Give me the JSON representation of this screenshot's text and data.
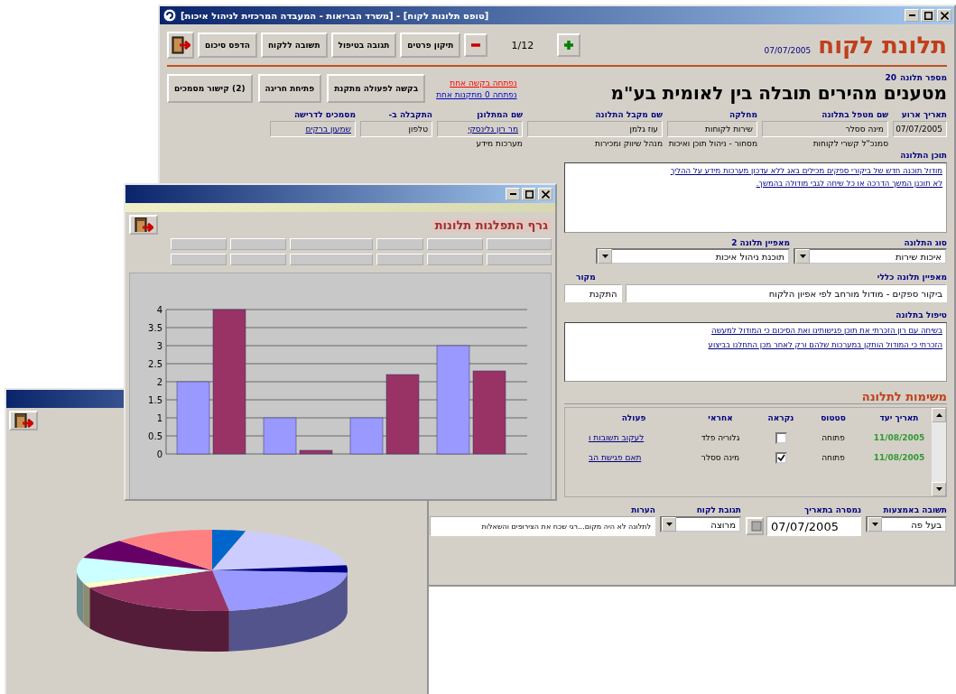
{
  "main_window": {
    "title": "[משרד הבריאות - המעבדה המרכזית לניהול איכות] - [טופס תלונות לקוח]",
    "form_title": "תלונת לקוח",
    "form_date": "07/07/2005",
    "toolbar_buttons": [
      "תיקון פרטים",
      "תגובה בטיפול",
      "תשובה ללקוח",
      "הדפס סיכום"
    ],
    "record_position": "1/12",
    "complaint_number_label": "מספר תלונה",
    "complaint_number": "20",
    "customer_name": "מטענים מהירים תובלה בין לאומית בע\"מ",
    "status_links": [
      {
        "text": "נפתחה בקשה אחת",
        "color": "#ff0000"
      },
      {
        "text": "נפתחה 0 מתקנות אחת",
        "color": "#0000cc"
      }
    ],
    "action_buttons": [
      "בקשה לפעולה מתקנת",
      "פתיחת חריגה",
      "(2) קישור מסמכים"
    ],
    "fields": [
      {
        "label": "תאריך ארוע",
        "value": "07/07/2005",
        "kind": "text"
      },
      {
        "label": "שם מטפל בתלונה",
        "value": "מינה ססלר",
        "note": "סמנכ\"ל קשרי לקוחות",
        "kind": "text"
      },
      {
        "label": "מחלקה",
        "value": "שירות לקוחות",
        "note": "מסחור - ניהול תוכן ואיכות",
        "kind": "text"
      },
      {
        "label": "שם מקבל התלונה",
        "value": "עוז גלמן",
        "note": "מנהל שיווק ומכירות",
        "kind": "text"
      },
      {
        "label": "שם המתלונן",
        "value": "מר רון גלינסקי",
        "note": "מערכות מידע",
        "kind": "link"
      },
      {
        "label": "התקבלה ב-",
        "value": "טלפון",
        "kind": "text"
      },
      {
        "label": "מסמכים לדרישה",
        "value": "שמעון ברקים",
        "kind": "link"
      }
    ],
    "content_label": "תוכן התלונה",
    "content_lines": [
      "מודול תוכנה חדש של ביקורי ספקים מכילים באג ללא עדכון מערכות מידע על ההליך",
      "לא תוכנן המשך הדרכה או כל שיחה לגבי מודולה בהמשך."
    ],
    "type_fields": [
      {
        "label": "סוג התלונה",
        "value": "איכות שירות"
      },
      {
        "label": "מאפיין תלונה 2",
        "value": "תוכנת ניהול איכות"
      }
    ],
    "general_label": "מאפיין תלונה כללי",
    "general_value": "ביקור ספקים - מודול מורחב לפי אפיון הלקוח",
    "source_label": "מקור",
    "source_value": "התקנת",
    "handling_label": "טיפול בתלונה",
    "handling_lines": [
      "בשיחה עם רון הזכרתי את תוכן פגישותינו ואת הסיכום כי המודול למעשה",
      "הזכרתי כי המודול הותקן במערכות שלהם ורק לאחר מכן התחלנו בביצוע"
    ],
    "tasks": {
      "title": "משימות לתלונה",
      "columns": [
        "תאריך יעד",
        "סטטוס",
        "נקראה",
        "אחראי",
        "פעולה"
      ],
      "rows": [
        {
          "due": "11/08/2005",
          "status": "פתוחה",
          "read": false,
          "owner": "גלוריה פלד",
          "action": "לעקוב תשובות ו"
        },
        {
          "due": "11/08/2005",
          "status": "פתוחה",
          "read": true,
          "owner": "מינה ססלר",
          "action": "תאם פגישת הב"
        }
      ]
    },
    "reply": [
      {
        "label": "תשובה באמצעות",
        "value": "בעל פה",
        "kind": "combo"
      },
      {
        "label": "נמסרה בתאריך",
        "value": "07/07/2005",
        "kind": "date"
      },
      {
        "label": "תגובת לקוח",
        "value": "מרוצה",
        "kind": "combo"
      },
      {
        "label": "הערות",
        "value": "לתלונה לא היה מקום...רגי שכח את הצירופים והשאלות",
        "kind": "text"
      }
    ]
  },
  "chart_window": {
    "heading": "גרף התפלגות תלונות",
    "chart_data": {
      "type": "bar",
      "grid": true,
      "yticks": [
        0,
        0.5,
        1,
        1.5,
        2,
        2.5,
        3,
        3.5,
        4
      ],
      "ylim": [
        0,
        4
      ],
      "series": [
        {
          "color": "#9999ff",
          "values": [
            2,
            1,
            1,
            3
          ]
        },
        {
          "color": "#993366",
          "values": [
            4,
            0.1,
            2.2,
            2.3
          ]
        }
      ]
    }
  }
}
